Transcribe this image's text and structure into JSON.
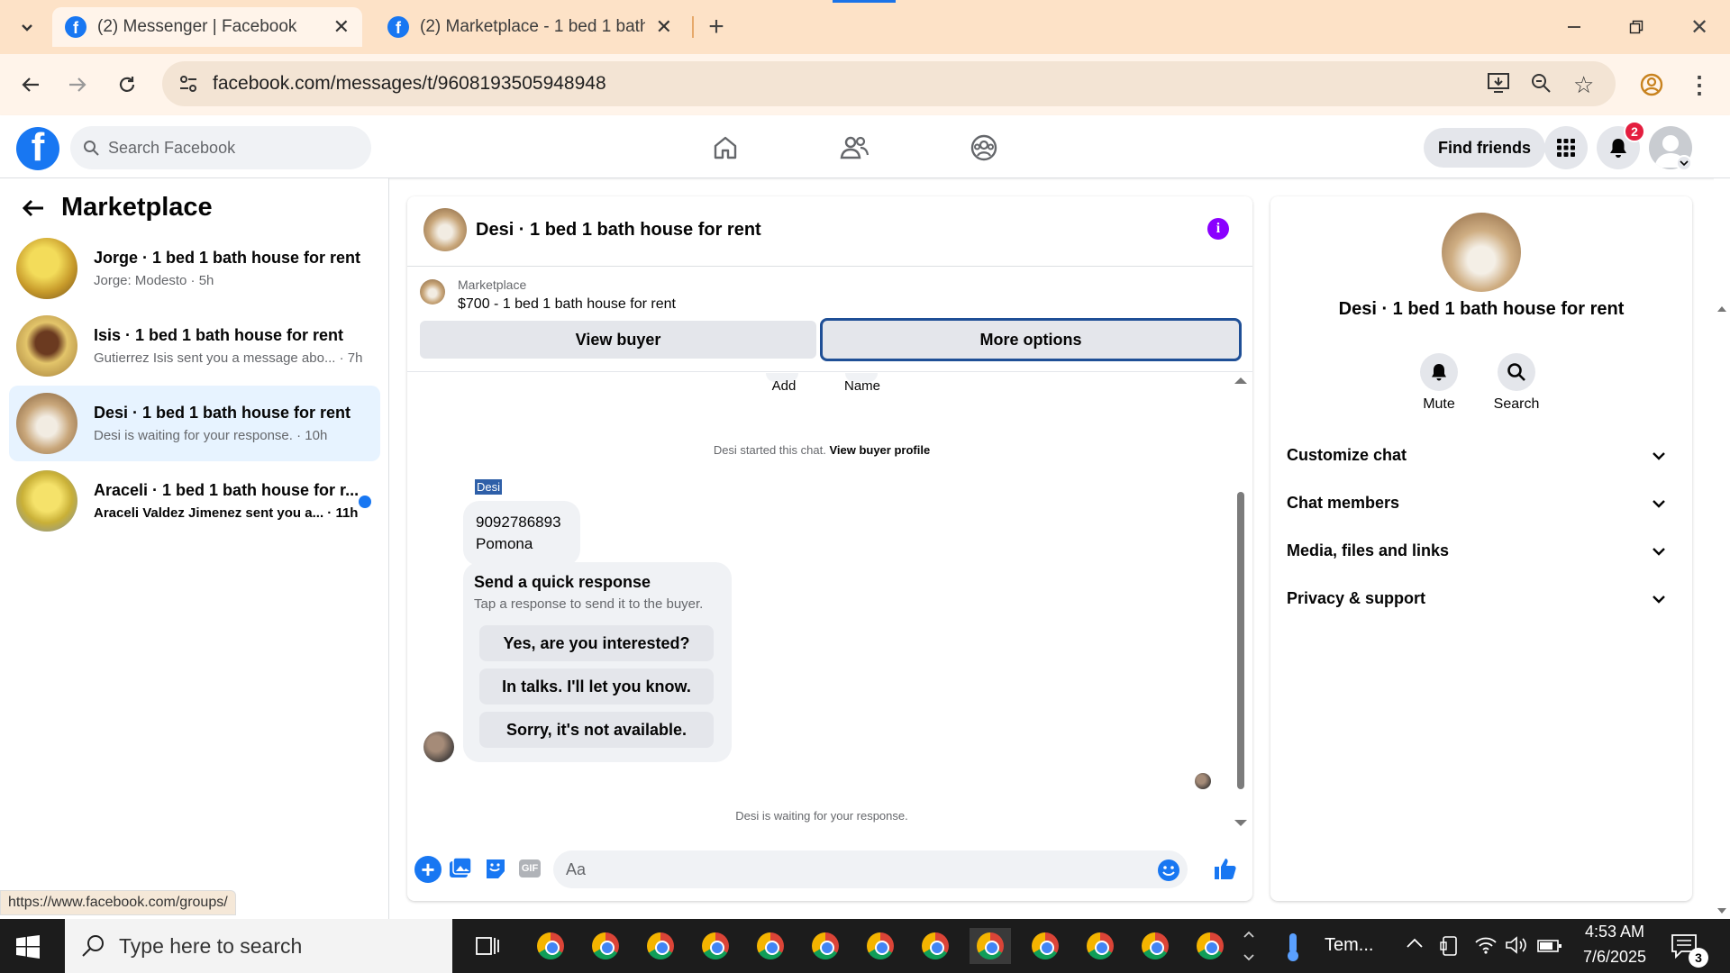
{
  "browser": {
    "tabs": [
      {
        "title": "(2) Messenger | Facebook",
        "active": true
      },
      {
        "title": "(2) Marketplace - 1 bed 1 bath h",
        "active": false
      }
    ],
    "url": "facebook.com/messages/t/9608193505948948",
    "status_url": "https://www.facebook.com/groups/"
  },
  "fb_header": {
    "search_placeholder": "Search Facebook",
    "find_friends": "Find friends",
    "notification_count": "2"
  },
  "left_panel": {
    "title": "Marketplace",
    "conversations": [
      {
        "title": "Jorge · 1 bed 1 bath house for rent",
        "snippet": "Jorge: Modesto · 5h",
        "unread": false,
        "selected": false,
        "thumb_color": "#d8b23a"
      },
      {
        "title": "Isis · 1 bed 1 bath house for rent",
        "snippet": "Gutierrez Isis sent you a message abo... · 7h",
        "unread": false,
        "selected": false,
        "thumb_color": "#c9a24a"
      },
      {
        "title": "Desi · 1 bed 1 bath house for rent",
        "snippet": "Desi is waiting for your response. · 10h",
        "unread": false,
        "selected": true,
        "thumb_color": "#b89a6e"
      },
      {
        "title": "Araceli · 1 bed 1 bath house for r...",
        "snippet": "Araceli Valdez Jimenez sent you a... · 11h",
        "unread": true,
        "selected": false,
        "thumb_color": "#d9c23a"
      }
    ]
  },
  "chat": {
    "title": "Desi · 1 bed 1 bath house for rent",
    "listing_source": "Marketplace",
    "listing_title": "$700 - 1 bed 1 bath house for rent",
    "view_buyer": "View buyer",
    "more_options": "More options",
    "top_actions": [
      "Add",
      "Name"
    ],
    "started_text": "Desi started this chat.",
    "view_buyer_profile": "View buyer profile",
    "sender_name": "Desi",
    "message_line1": "9092786893",
    "message_line2": "Pomona",
    "quick_title": "Send a quick response",
    "quick_subtitle": "Tap a response to send it to the buyer.",
    "quick_responses": [
      "Yes, are you interested?",
      "In talks. I'll let you know.",
      "Sorry, it's not available."
    ],
    "waiting_text": "Desi is waiting for your response.",
    "composer_placeholder": "Aa"
  },
  "right_panel": {
    "title": "Desi · 1 bed 1 bath house for rent",
    "mute": "Mute",
    "search": "Search",
    "sections": [
      "Customize chat",
      "Chat members",
      "Media, files and links",
      "Privacy & support"
    ]
  },
  "taskbar": {
    "search_placeholder": "Type here to search",
    "weather": "Tem...",
    "time": "4:53 AM",
    "date": "7/6/2025",
    "notification_count": "3"
  },
  "colors": {
    "fb_blue": "#1877f2",
    "selected_bg": "#e7f3ff",
    "purple_info": "#8a00ff",
    "chrome_bar": "#fde2c7"
  }
}
